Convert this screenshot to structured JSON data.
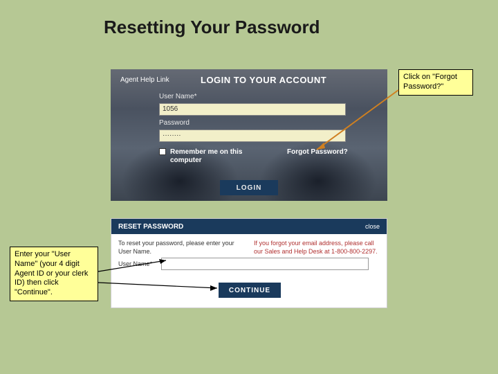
{
  "title": "Resetting Your Password",
  "callouts": {
    "forgot": "Click on \"Forgot Password?\"",
    "usernote": "Enter your \"User Name\" (your 4 digit Agent ID or your clerk ID) then click \"Continue\"."
  },
  "login": {
    "agent_help": "Agent Help Link",
    "heading": "LOGIN TO YOUR ACCOUNT",
    "user_label": "User Name*",
    "user_value": "1056",
    "pass_label": "Password",
    "pass_value": "········",
    "remember_label": "Remember me on this computer",
    "forgot_label": "Forgot Password?",
    "login_btn": "LOGIN"
  },
  "reset": {
    "header_title": "RESET PASSWORD",
    "close_label": "close",
    "instruction": "To reset your password, please enter your User Name.",
    "help_text": "If you forgot your email address, please call our Sales and Help Desk at 1-800-800-2297.",
    "username_label": "User Name*",
    "continue_btn": "CONTINUE"
  }
}
